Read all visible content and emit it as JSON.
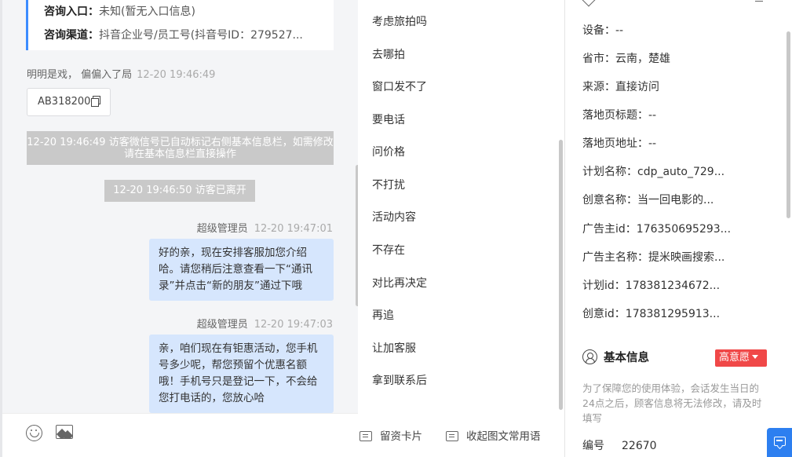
{
  "chat": {
    "info_card": {
      "entry_label": "咨询入口：",
      "entry_value": "未知(暂无入口信息)",
      "channel_label": "咨询渠道：",
      "channel_value": "抖音企业号/员工号(抖音号ID：279527..."
    },
    "visitor_message": {
      "name": "明明是戏， 偏偏入了局",
      "time": "12-20 19:46:49",
      "code": "AB318200"
    },
    "system_notice": "12-20 19:46:49 访客微信号已自动标记右侧基本信息栏，如需修改请在基本信息栏直接操作",
    "system_leave": "12-20 19:46:50 访客已离开",
    "messages": [
      {
        "sender": "超级管理员",
        "time": "12-20 19:47:01",
        "text": "好的亲，现在安排客服加您介绍哈。请您稍后注意查看一下“通讯录”并点击“新的朋友”通过下哦"
      },
      {
        "sender": "超级管理员",
        "time": "12-20 19:47:03",
        "text": "亲，咱们现在有钜惠活动，您手机号多少呢，帮您预留个优惠名额哦！手机号只是登记一下，不会给您打电话的，您放心哈"
      }
    ],
    "toolbar": {
      "emoji_icon": "emoji-icon",
      "image_icon": "image-icon"
    }
  },
  "quick_phrases": [
    "考虑旅拍吗",
    "去哪拍",
    "窗口发不了",
    "要电话",
    "问价格",
    "不打扰",
    "活动内容",
    "不存在",
    "对比再决定",
    "再追",
    "让加客服",
    "拿到联系后"
  ],
  "bottom_bar": {
    "card_label": "留资卡片",
    "collapse_label": "收起图文常用语"
  },
  "info_panel": {
    "fields": [
      {
        "label": "设备：",
        "value": "--"
      },
      {
        "label": "省市：",
        "value": "云南，楚雄"
      },
      {
        "label": "来源：",
        "value": "直接访问"
      },
      {
        "label": "落地页标题：",
        "value": "--"
      },
      {
        "label": "落地页地址：",
        "value": "--"
      },
      {
        "label": "计划名称：",
        "value": "cdp_auto_729..."
      },
      {
        "label": "创意名称：",
        "value": "当一回电影的..."
      },
      {
        "label": "广告主id：",
        "value": "176350695293..."
      },
      {
        "label": "广告主名称：",
        "value": "提米映画搜索..."
      },
      {
        "label": "计划id：",
        "value": "178381234672..."
      },
      {
        "label": "创意id：",
        "value": "178381295913..."
      }
    ],
    "basic_info": {
      "title": "基本信息",
      "intent_badge": "高意愿",
      "hint": "为了保障您的使用体验，会话发生当日的24点之后，顾客信息将无法修改，请及时填写",
      "code_label": "编号",
      "code_value": "22670"
    }
  },
  "colors": {
    "accent": "#3c8cff",
    "bubble": "#d6e6fd",
    "badge": "#f04848",
    "system": "#c9c9c9",
    "fab": "#2d7ff0"
  }
}
